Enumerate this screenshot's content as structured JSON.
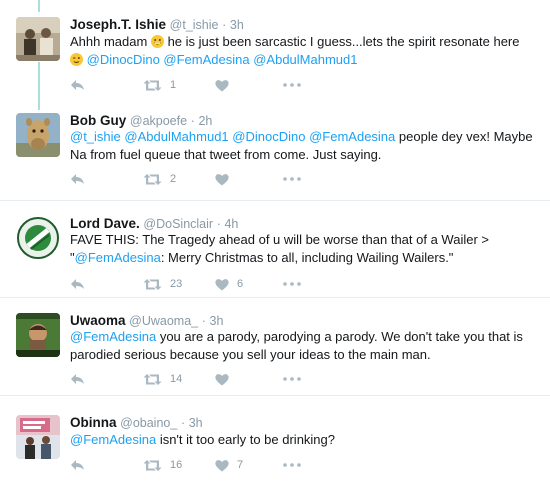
{
  "tweets": [
    {
      "name": "Joseph.T. Ishie",
      "handle": "@t_ishie",
      "time": "3h",
      "text_a": "Ahhh madam",
      "text_b": "he is just been sarcastic I guess...lets the spirit resonate here",
      "mentions": [
        "@DinocDino",
        "@FemAdesina",
        "@AbdulMahmud1"
      ],
      "retweets": "1",
      "likes": "",
      "emoji1": "grinning-face-emoji",
      "emoji2": "winking-face-emoji"
    },
    {
      "name": "Bob Guy",
      "handle": "@akpoefe",
      "time": "2h",
      "mentions": [
        "@t_ishie",
        "@AbdulMahmud1",
        "@DinocDino",
        "@FemAdesina"
      ],
      "text_a": "people dey vex! Maybe Na from fuel queue that tweet from come. Just saying.",
      "retweets": "2",
      "likes": ""
    },
    {
      "name": "Lord Dave.",
      "handle": "@DoSinclair",
      "time": "4h",
      "text_a": "FAVE THIS: The Tragedy ahead of u will be worse than that of a Wailer >",
      "quote_open": "\"",
      "mention": "@FemAdesina",
      "text_b": ": Merry Christmas to all, including Wailing Wailers.\"",
      "retweets": "23",
      "likes": "6"
    },
    {
      "name": "Uwaoma",
      "handle": "@Uwaoma_",
      "time": "3h",
      "mention": "@FemAdesina",
      "text_a": "you are a parody, parodying a parody. We don't take you that is parodied serious because you sell your ideas to the main man.",
      "retweets": "14",
      "likes": ""
    },
    {
      "name": "Obinna",
      "handle": "@obaino_",
      "time": "3h",
      "mention": "@FemAdesina",
      "text_a": "isn't it too early to be drinking?",
      "retweets": "16",
      "likes": "7"
    }
  ],
  "colors": {
    "link": "#1da1f2",
    "icon": "#aab8c2",
    "thread": "#aadfe0",
    "divider": "#e6ecf0"
  }
}
